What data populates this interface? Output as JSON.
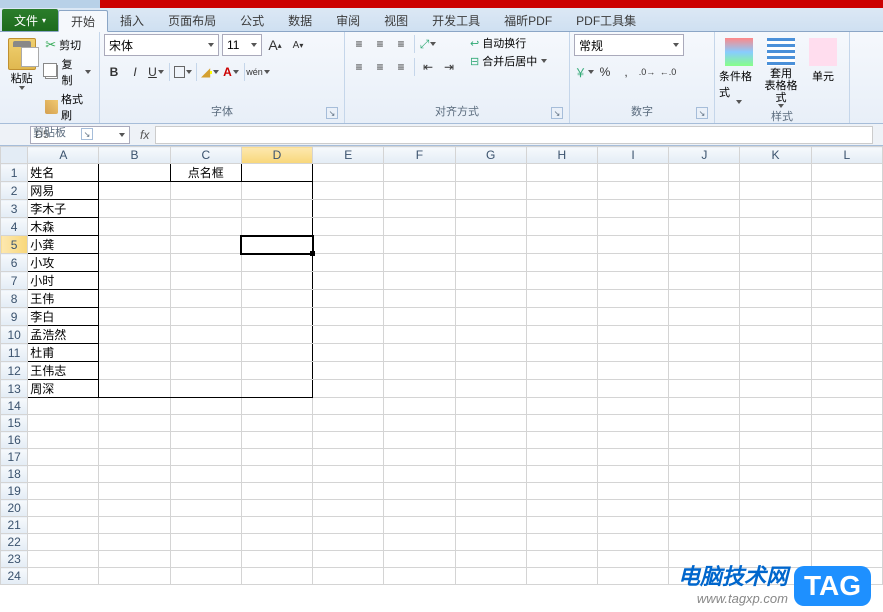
{
  "tabs": {
    "file": "文件",
    "items": [
      "开始",
      "插入",
      "页面布局",
      "公式",
      "数据",
      "审阅",
      "视图",
      "开发工具",
      "福昕PDF",
      "PDF工具集"
    ],
    "active_index": 0
  },
  "clipboard": {
    "paste": "粘贴",
    "cut": "剪切",
    "copy": "复制",
    "format": "格式刷",
    "group": "剪贴板"
  },
  "font": {
    "name": "宋体",
    "size": "11",
    "grow": "A",
    "shrink": "A",
    "bold": "B",
    "italic": "I",
    "underline": "U",
    "phonetic": "wén",
    "group": "字体"
  },
  "align": {
    "wrap": "自动换行",
    "merge": "合并后居中",
    "group": "对齐方式"
  },
  "number": {
    "format": "常规",
    "percent": "%",
    "comma": ",",
    "group": "数字"
  },
  "styles": {
    "cond": "条件格式",
    "table": "套用\n表格格式",
    "cell": "单元",
    "group": "样式"
  },
  "namebox": "D5",
  "fx": "fx",
  "columns": [
    "A",
    "B",
    "C",
    "D",
    "E",
    "F",
    "G",
    "H",
    "I",
    "J",
    "K",
    "L"
  ],
  "active_col": "D",
  "active_row": 5,
  "data": {
    "A1": "姓名",
    "C1": "点名框",
    "A2": "网易",
    "A3": "李木子",
    "A4": "木森",
    "A5": "小龚",
    "A6": "小攻",
    "A7": "小时",
    "A8": "王伟",
    "A9": "李白",
    "A10": "孟浩然",
    "A11": "杜甫",
    "A12": "王伟志",
    "A13": "周深"
  },
  "rows": 24,
  "bordered_region": {
    "r1": 1,
    "c1": 1,
    "r2": 13,
    "c2": 4
  },
  "watermark": {
    "title": "电脑技术网",
    "url": "www.tagxp.com",
    "tag": "TAG"
  }
}
